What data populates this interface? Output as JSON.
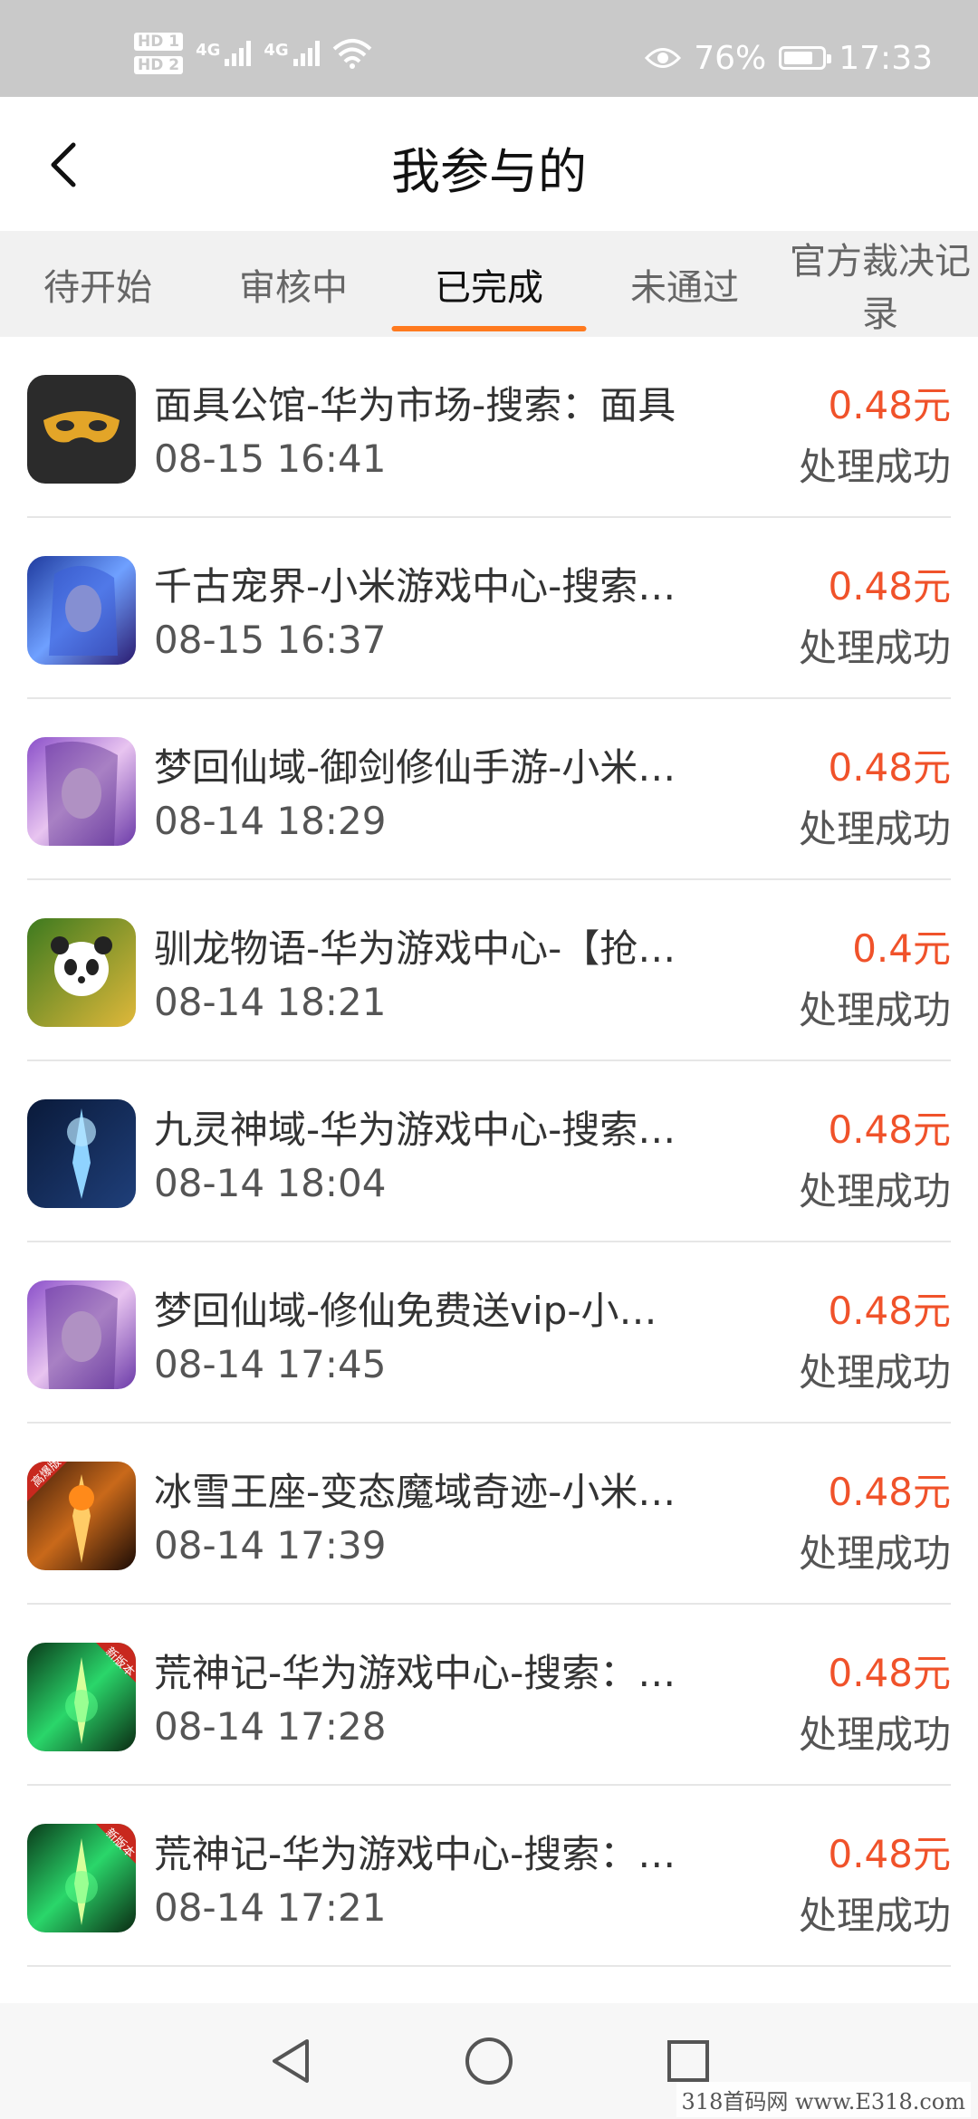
{
  "status_bar": {
    "sim1": "HD 1",
    "sim2": "HD 2",
    "net1": "4G",
    "net2": "4G",
    "battery_percent": "76%",
    "battery_level": 0.76,
    "time": "17:33"
  },
  "header": {
    "title": "我参与的"
  },
  "tabs": [
    {
      "label": "待开始"
    },
    {
      "label": "审核中"
    },
    {
      "label": "已完成"
    },
    {
      "label": "未通过"
    },
    {
      "label": "官方裁决记录"
    }
  ],
  "active_tab": "已完成",
  "records": [
    {
      "title": "面具公馆-华为市场-搜索：面具",
      "time": "08-15 16:41",
      "reward": "0.48元",
      "status": "处理成功",
      "icon": "mask-icon"
    },
    {
      "title": "千古宠界-小米游戏中心-搜索…",
      "time": "08-15 16:37",
      "reward": "0.48元",
      "status": "处理成功",
      "icon": "blue-hero-icon"
    },
    {
      "title": "梦回仙域-御剑修仙手游-小米…",
      "time": "08-14 18:29",
      "reward": "0.48元",
      "status": "处理成功",
      "icon": "fairy-girl-icon"
    },
    {
      "title": "驯龙物语-华为游戏中心-【抢…",
      "time": "08-14 18:21",
      "reward": "0.4元",
      "status": "处理成功",
      "icon": "panda-icon"
    },
    {
      "title": "九灵神域-华为游戏中心-搜索…",
      "time": "08-14 18:04",
      "reward": "0.48元",
      "status": "处理成功",
      "icon": "sword-icon"
    },
    {
      "title": "梦回仙域-修仙免费送vip-小…",
      "time": "08-14 17:45",
      "reward": "0.48元",
      "status": "处理成功",
      "icon": "fairy-girl-icon"
    },
    {
      "title": "冰雪王座-变态魔域奇迹-小米…",
      "time": "08-14 17:39",
      "reward": "0.48元",
      "status": "处理成功",
      "icon": "flame-sword-icon"
    },
    {
      "title": "荒神记-华为游戏中心-搜索：…",
      "time": "08-14 17:28",
      "reward": "0.48元",
      "status": "处理成功",
      "icon": "green-sword-icon"
    },
    {
      "title": "荒神记-华为游戏中心-搜索：…",
      "time": "08-14 17:21",
      "reward": "0.48元",
      "status": "处理成功",
      "icon": "green-sword-icon"
    }
  ],
  "icon_badges": {
    "flame": "高爆版",
    "new": "新版本"
  },
  "nav": {
    "back": "back-triangle-icon",
    "home": "home-circle-icon",
    "recents": "recents-square-icon"
  },
  "watermark": "318首码网 www.E318.com",
  "colors": {
    "accent": "#ff7a1f",
    "reward": "#f0522a",
    "status_bar": "#c9c9c9",
    "tab_bg": "#f1f1f1"
  }
}
